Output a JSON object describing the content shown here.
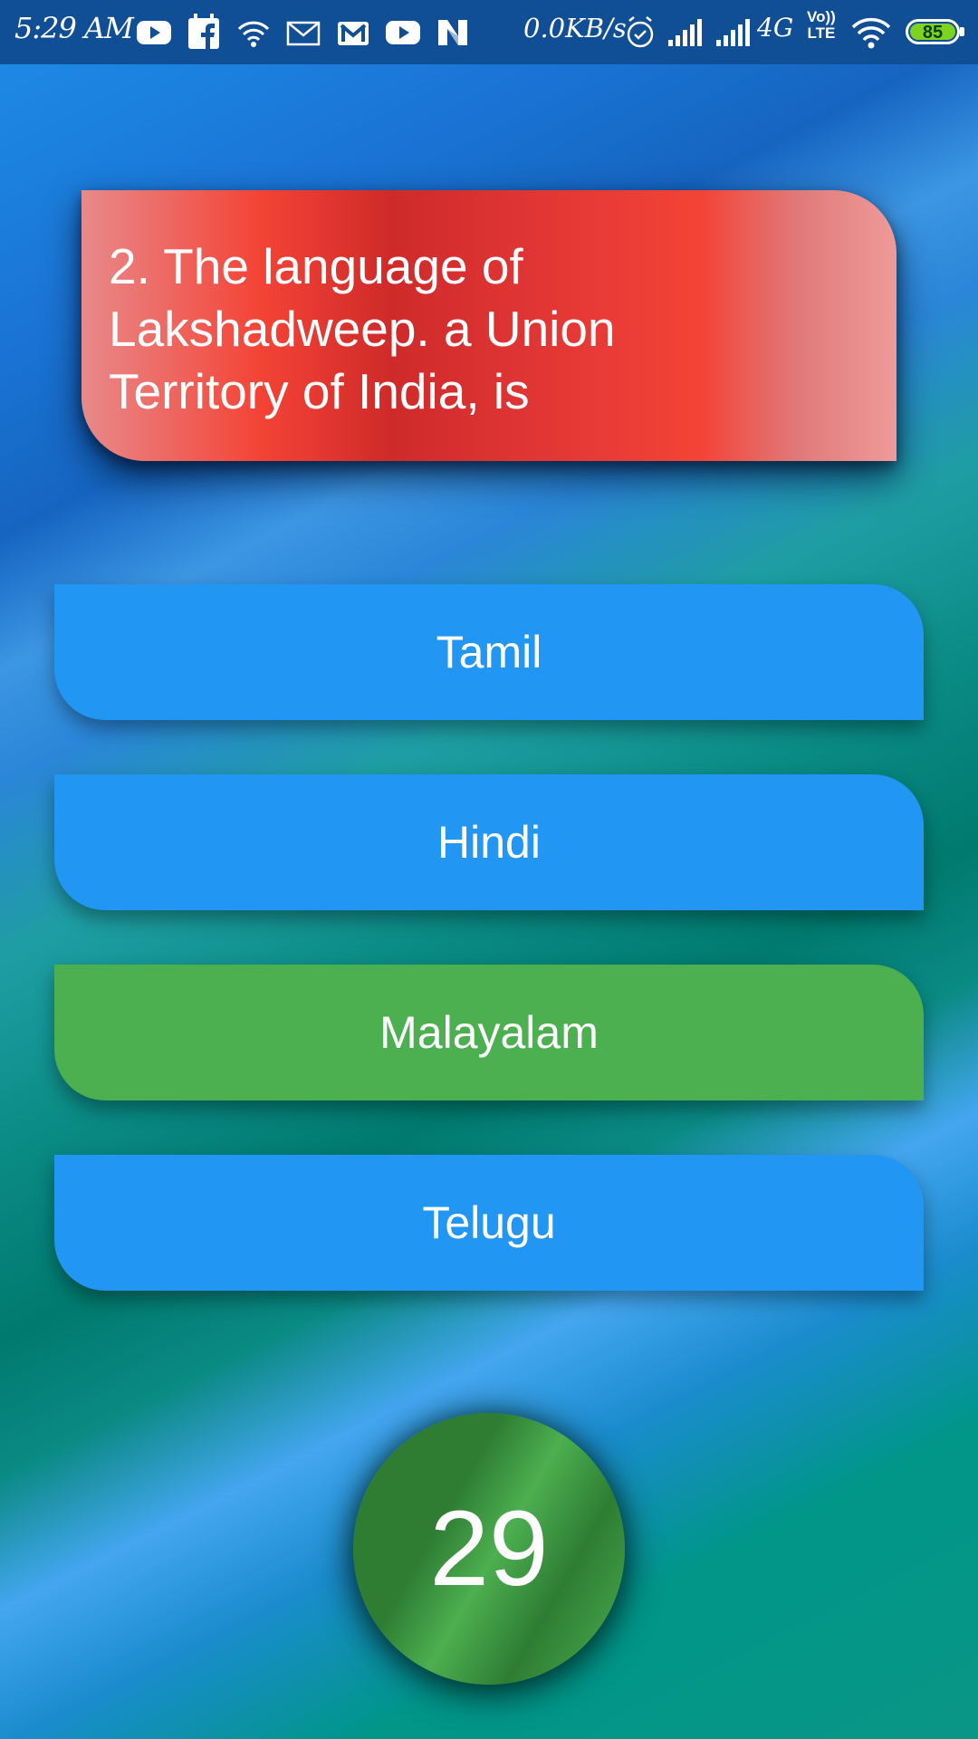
{
  "status_bar": {
    "time": "5:29 AM",
    "network_speed": "0.0KB/s",
    "network_type": "4G",
    "volte_top": "Vo))",
    "volte_bottom": "LTE",
    "battery": "85"
  },
  "question": {
    "text": "2. The language of Lakshadweep. a Union Territory of India, is"
  },
  "answers": [
    {
      "label": "Tamil",
      "state": "default"
    },
    {
      "label": "Hindi",
      "state": "default"
    },
    {
      "label": "Malayalam",
      "state": "correct"
    },
    {
      "label": "Telugu",
      "state": "default"
    }
  ],
  "timer": {
    "value": "29"
  },
  "colors": {
    "question_red": "#f44336",
    "answer_blue": "#2196f3",
    "answer_correct_green": "#4caf50",
    "timer_green": "#2e7d32",
    "status_bar": "#104e96"
  }
}
